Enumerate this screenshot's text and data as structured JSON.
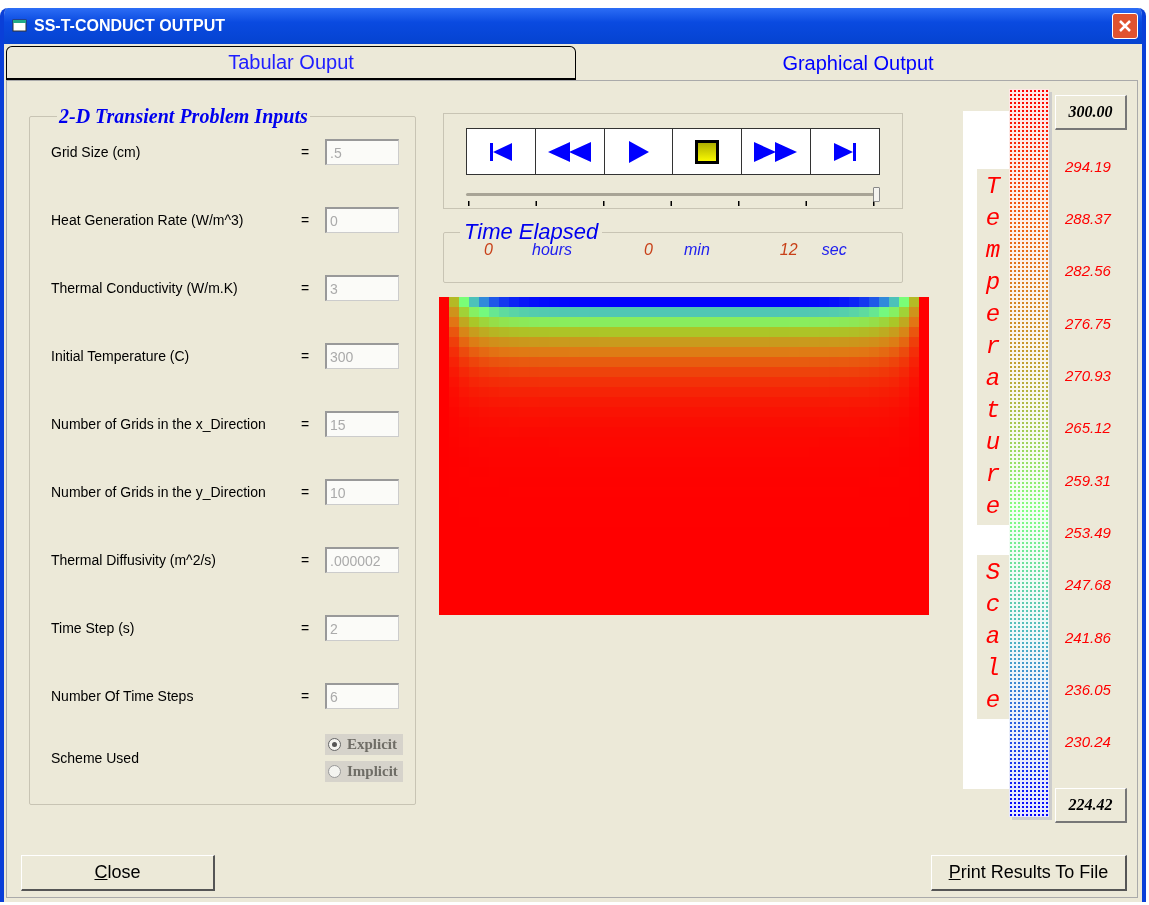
{
  "window": {
    "title": "SS-T-CONDUCT OUTPUT"
  },
  "tabs": [
    {
      "label": "Tabular Ouput",
      "selected": false
    },
    {
      "label": "Graphical Output",
      "selected": true
    }
  ],
  "inputs": {
    "title": "2-D Transient Problem Inputs",
    "fields": [
      {
        "label": "Grid Size (cm)",
        "sign": "=",
        "value": ".5",
        "disabled": true
      },
      {
        "label": "Heat Generation Rate (W/m^3)",
        "sign": "=",
        "value": "0",
        "disabled": true
      },
      {
        "label": "Thermal Conductivity (W/m.K)",
        "sign": "=",
        "value": "3",
        "disabled": true
      },
      {
        "label": "Initial Temperature (C)",
        "sign": "=",
        "value": "300",
        "disabled": true
      },
      {
        "label": "Number of Grids in the x_Direction",
        "sign": "=",
        "value": "15",
        "disabled": true
      },
      {
        "label": "Number of Grids in the y_Direction",
        "sign": "=",
        "value": "10",
        "disabled": true
      },
      {
        "label": "Thermal Diffusivity (m^2/s)",
        "sign": "=",
        "value": ".000002",
        "disabled": true
      },
      {
        "label": "Time Step (s)",
        "sign": "=",
        "value": "2",
        "disabled": true
      },
      {
        "label": "Number Of Time Steps",
        "sign": "=",
        "value": "6",
        "disabled": true
      }
    ],
    "scheme": {
      "label": "Scheme Used",
      "options": [
        {
          "label": "Explicit",
          "selected": true,
          "disabled": true
        },
        {
          "label": "Implicit",
          "selected": false,
          "disabled": true
        }
      ]
    }
  },
  "player": {
    "slider": {
      "level": 1
    }
  },
  "time_elapsed": {
    "title": "Time Elapsed",
    "hours": "0",
    "hours_unit": "hours",
    "minutes": "0",
    "minutes_unit": "min",
    "seconds": "12",
    "seconds_unit": "sec"
  },
  "scale": {
    "title_1": "Temperature",
    "title_2": "Scale",
    "max": "300.00",
    "min": "224.42",
    "ticks": [
      "294.19",
      "288.37",
      "282.56",
      "276.75",
      "270.93",
      "265.12",
      "259.31",
      "253.49",
      "247.68",
      "241.86",
      "236.05",
      "230.24"
    ]
  },
  "buttons": {
    "close": "Close",
    "print": "Print Results To File"
  }
}
